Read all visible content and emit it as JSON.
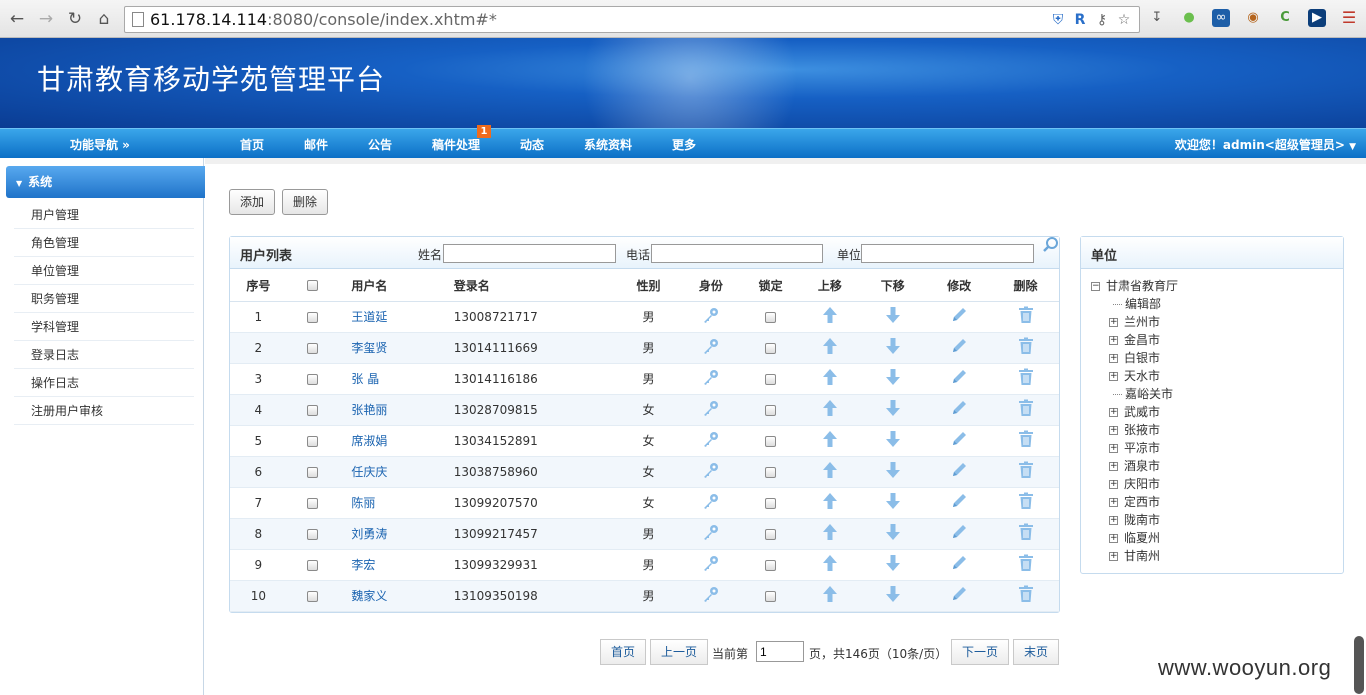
{
  "browser": {
    "url_host": "61.178.14.114",
    "url_rest": ":8080/console/index.xhtm#*"
  },
  "header": {
    "title": "甘肃教育移动学苑管理平台"
  },
  "menu": {
    "nav_label": "功能导航 »",
    "items": [
      "首页",
      "邮件",
      "公告",
      "稿件处理",
      "动态",
      "系统资料",
      "更多"
    ],
    "badge": "1",
    "welcome": "欢迎您！admin<超级管理员>"
  },
  "sidebar": {
    "section": "系统",
    "items": [
      "用户管理",
      "角色管理",
      "单位管理",
      "职务管理",
      "学科管理",
      "登录日志",
      "操作日志",
      "注册用户审核"
    ]
  },
  "toolbar": {
    "add": "添加",
    "delete": "删除"
  },
  "user_panel": {
    "title": "用户列表",
    "filter_name": "姓名",
    "filter_phone": "电话",
    "filter_unit": "单位",
    "columns": [
      "序号",
      "用户名",
      "登录名",
      "性别",
      "身份",
      "锁定",
      "上移",
      "下移",
      "修改",
      "删除"
    ],
    "rows": [
      {
        "no": "1",
        "name": "王道延",
        "login": "13008721717",
        "gender": "男"
      },
      {
        "no": "2",
        "name": "李玺贤",
        "login": "13014111669",
        "gender": "男"
      },
      {
        "no": "3",
        "name": "张 晶",
        "login": "13014116186",
        "gender": "男"
      },
      {
        "no": "4",
        "name": "张艳丽",
        "login": "13028709815",
        "gender": "女"
      },
      {
        "no": "5",
        "name": "席淑娟",
        "login": "13034152891",
        "gender": "女"
      },
      {
        "no": "6",
        "name": "任庆庆",
        "login": "13038758960",
        "gender": "女"
      },
      {
        "no": "7",
        "name": "陈丽",
        "login": "13099207570",
        "gender": "女"
      },
      {
        "no": "8",
        "name": "刘勇涛",
        "login": "13099217457",
        "gender": "男"
      },
      {
        "no": "9",
        "name": "李宏",
        "login": "13099329931",
        "gender": "男"
      },
      {
        "no": "10",
        "name": "魏家义",
        "login": "13109350198",
        "gender": "男"
      }
    ]
  },
  "unit_panel": {
    "title": "单位",
    "root": "甘肃省教育厅",
    "children": [
      {
        "label": "编辑部",
        "expandable": false
      },
      {
        "label": "兰州市",
        "expandable": true
      },
      {
        "label": "金昌市",
        "expandable": true
      },
      {
        "label": "白银市",
        "expandable": true
      },
      {
        "label": "天水市",
        "expandable": true
      },
      {
        "label": "嘉峪关市",
        "expandable": false
      },
      {
        "label": "武威市",
        "expandable": true
      },
      {
        "label": "张掖市",
        "expandable": true
      },
      {
        "label": "平凉市",
        "expandable": true
      },
      {
        "label": "酒泉市",
        "expandable": true
      },
      {
        "label": "庆阳市",
        "expandable": true
      },
      {
        "label": "定西市",
        "expandable": true
      },
      {
        "label": "陇南市",
        "expandable": true
      },
      {
        "label": "临夏州",
        "expandable": true
      },
      {
        "label": "甘南州",
        "expandable": true
      }
    ]
  },
  "pager": {
    "first": "首页",
    "prev": "上一页",
    "current_label": "当前第",
    "current_value": "1",
    "summary": "页，共146页（10条/页）",
    "next": "下一页",
    "last": "末页"
  },
  "watermark": "www.wooyun.org"
}
